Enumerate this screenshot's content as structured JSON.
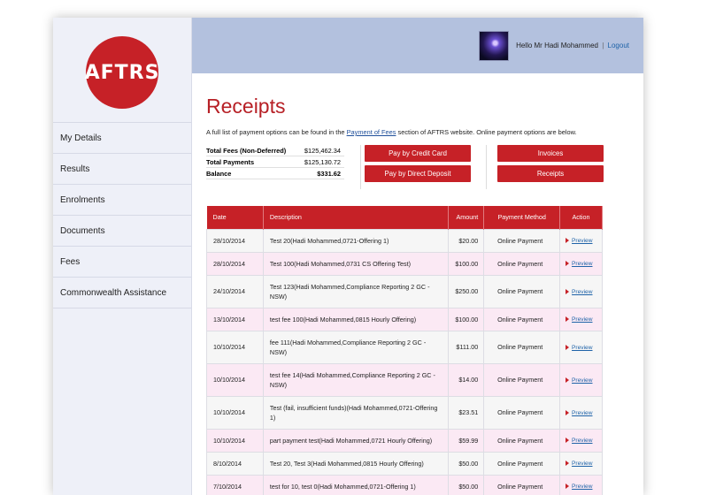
{
  "logo": {
    "text": "AFTRS"
  },
  "nav": [
    "My Details",
    "Results",
    "Enrolments",
    "Documents",
    "Fees",
    "Commonwealth Assistance"
  ],
  "header": {
    "hello": "Hello Mr Hadi Mohammed",
    "separator": "|",
    "logout": "Logout"
  },
  "page": {
    "title": "Receipts",
    "intro_before": "A full list of payment options can be found in the ",
    "intro_link": "Payment of Fees",
    "intro_after": " section of AFTRS website. Online payment options are below."
  },
  "totals": [
    {
      "label": "Total Fees (Non-Deferred)",
      "value": "$125,462.34"
    },
    {
      "label": "Total Payments",
      "value": "$125,130.72"
    },
    {
      "label": "Balance",
      "value": "$331.62"
    }
  ],
  "buttons": {
    "credit_card": "Pay by Credit Card",
    "direct_deposit": "Pay by Direct Deposit",
    "invoices": "Invoices",
    "receipts": "Receipts"
  },
  "table": {
    "headers": [
      "Date",
      "Description",
      "Amount",
      "Payment Method",
      "Action"
    ],
    "rows": [
      {
        "date": "28/10/2014",
        "description": "Test 20(Hadi Mohammed,0721-Offering 1)",
        "amount": "$20.00",
        "method": "Online Payment",
        "action": "Preview"
      },
      {
        "date": "28/10/2014",
        "description": "Test 100(Hadi Mohammed,0731 CS Offering Test)",
        "amount": "$100.00",
        "method": "Online Payment",
        "action": "Preview"
      },
      {
        "date": "24/10/2014",
        "description": "Test 123(Hadi Mohammed,Compliance Reporting 2 GC - NSW)",
        "amount": "$250.00",
        "method": "Online Payment",
        "action": "Preview"
      },
      {
        "date": "13/10/2014",
        "description": "test fee 100(Hadi Mohammed,0815 Hourly Offering)",
        "amount": "$100.00",
        "method": "Online Payment",
        "action": "Preview"
      },
      {
        "date": "10/10/2014",
        "description": "fee 111(Hadi Mohammed,Compliance Reporting 2 GC - NSW)",
        "amount": "$111.00",
        "method": "Online Payment",
        "action": "Preview"
      },
      {
        "date": "10/10/2014",
        "description": "test fee 14(Hadi Mohammed,Compliance Reporting 2 GC - NSW)",
        "amount": "$14.00",
        "method": "Online Payment",
        "action": "Preview"
      },
      {
        "date": "10/10/2014",
        "description": "Test (fail, insufficient funds)(Hadi Mohammed,0721-Offering 1)",
        "amount": "$23.51",
        "method": "Online Payment",
        "action": "Preview"
      },
      {
        "date": "10/10/2014",
        "description": "part payment test(Hadi Mohammed,0721 Hourly Offering)",
        "amount": "$59.99",
        "method": "Online Payment",
        "action": "Preview"
      },
      {
        "date": "8/10/2014",
        "description": "Test 20, Test 3(Hadi Mohammed,0815 Hourly Offering)",
        "amount": "$50.00",
        "method": "Online Payment",
        "action": "Preview"
      },
      {
        "date": "7/10/2014",
        "description": "test for 10, test 0(Hadi Mohammed,0721-Offering 1)",
        "amount": "$50.00",
        "method": "Online Payment",
        "action": "Preview"
      }
    ]
  },
  "colors": {
    "accent": "#c62127",
    "header_bg": "#b3c1de",
    "sidebar_bg": "#eef0f8",
    "row_even": "#fbe9f4",
    "row_odd": "#f6f6f6",
    "link": "#1f63a8"
  }
}
